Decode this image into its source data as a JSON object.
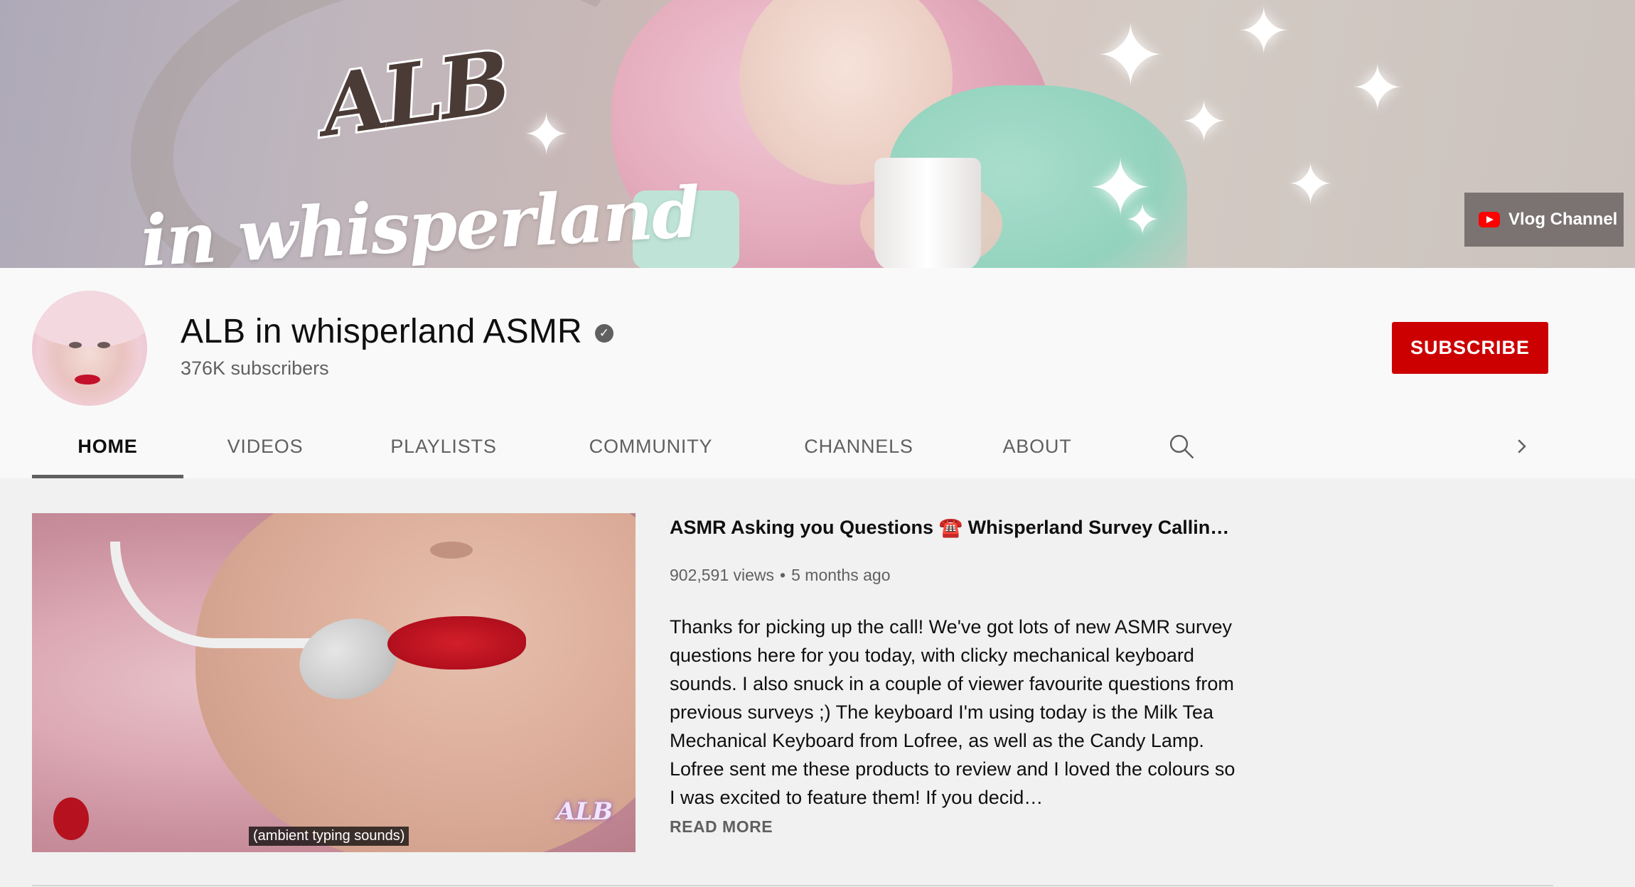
{
  "banner": {
    "logo_alb": "ALB",
    "logo_tagline": "in whisperland",
    "vlog_link_label": "Vlog Channel"
  },
  "channel": {
    "name": "ALB in whisperland ASMR",
    "subscribers": "376K subscribers",
    "subscribe_label": "SUBSCRIBE"
  },
  "tabs": [
    {
      "label": "HOME",
      "active": true
    },
    {
      "label": "VIDEOS"
    },
    {
      "label": "PLAYLISTS"
    },
    {
      "label": "COMMUNITY"
    },
    {
      "label": "CHANNELS"
    },
    {
      "label": "ABOUT"
    }
  ],
  "icons": {
    "verified": "verified-check-icon",
    "search": "search-icon",
    "more": "chevron-right-icon",
    "youtube": "youtube-logo-icon"
  },
  "colors": {
    "subscribe_red": "#cc0000",
    "text_primary": "#0f0f0f",
    "text_secondary": "#606060"
  },
  "featured_video": {
    "title": "ASMR Asking you Questions ☎️ Whisperland Survey Calling (s…",
    "views": "902,591 views",
    "separator": "•",
    "age": "5 months ago",
    "description": "Thanks for picking up the call! We've got lots of new ASMR survey questions here for you today, with clicky mechanical keyboard sounds. I also snuck in a couple of viewer favourite questions from previous surveys ;) The keyboard I'm using today is the Milk Tea Mechanical Keyboard from Lofree, as well as the Candy Lamp. Lofree sent me these products to review and I loved the colours so I was excited to feature them! If you decid…",
    "read_more": "READ MORE",
    "caption": "(ambient typing sounds)",
    "watermark": "ALB"
  }
}
